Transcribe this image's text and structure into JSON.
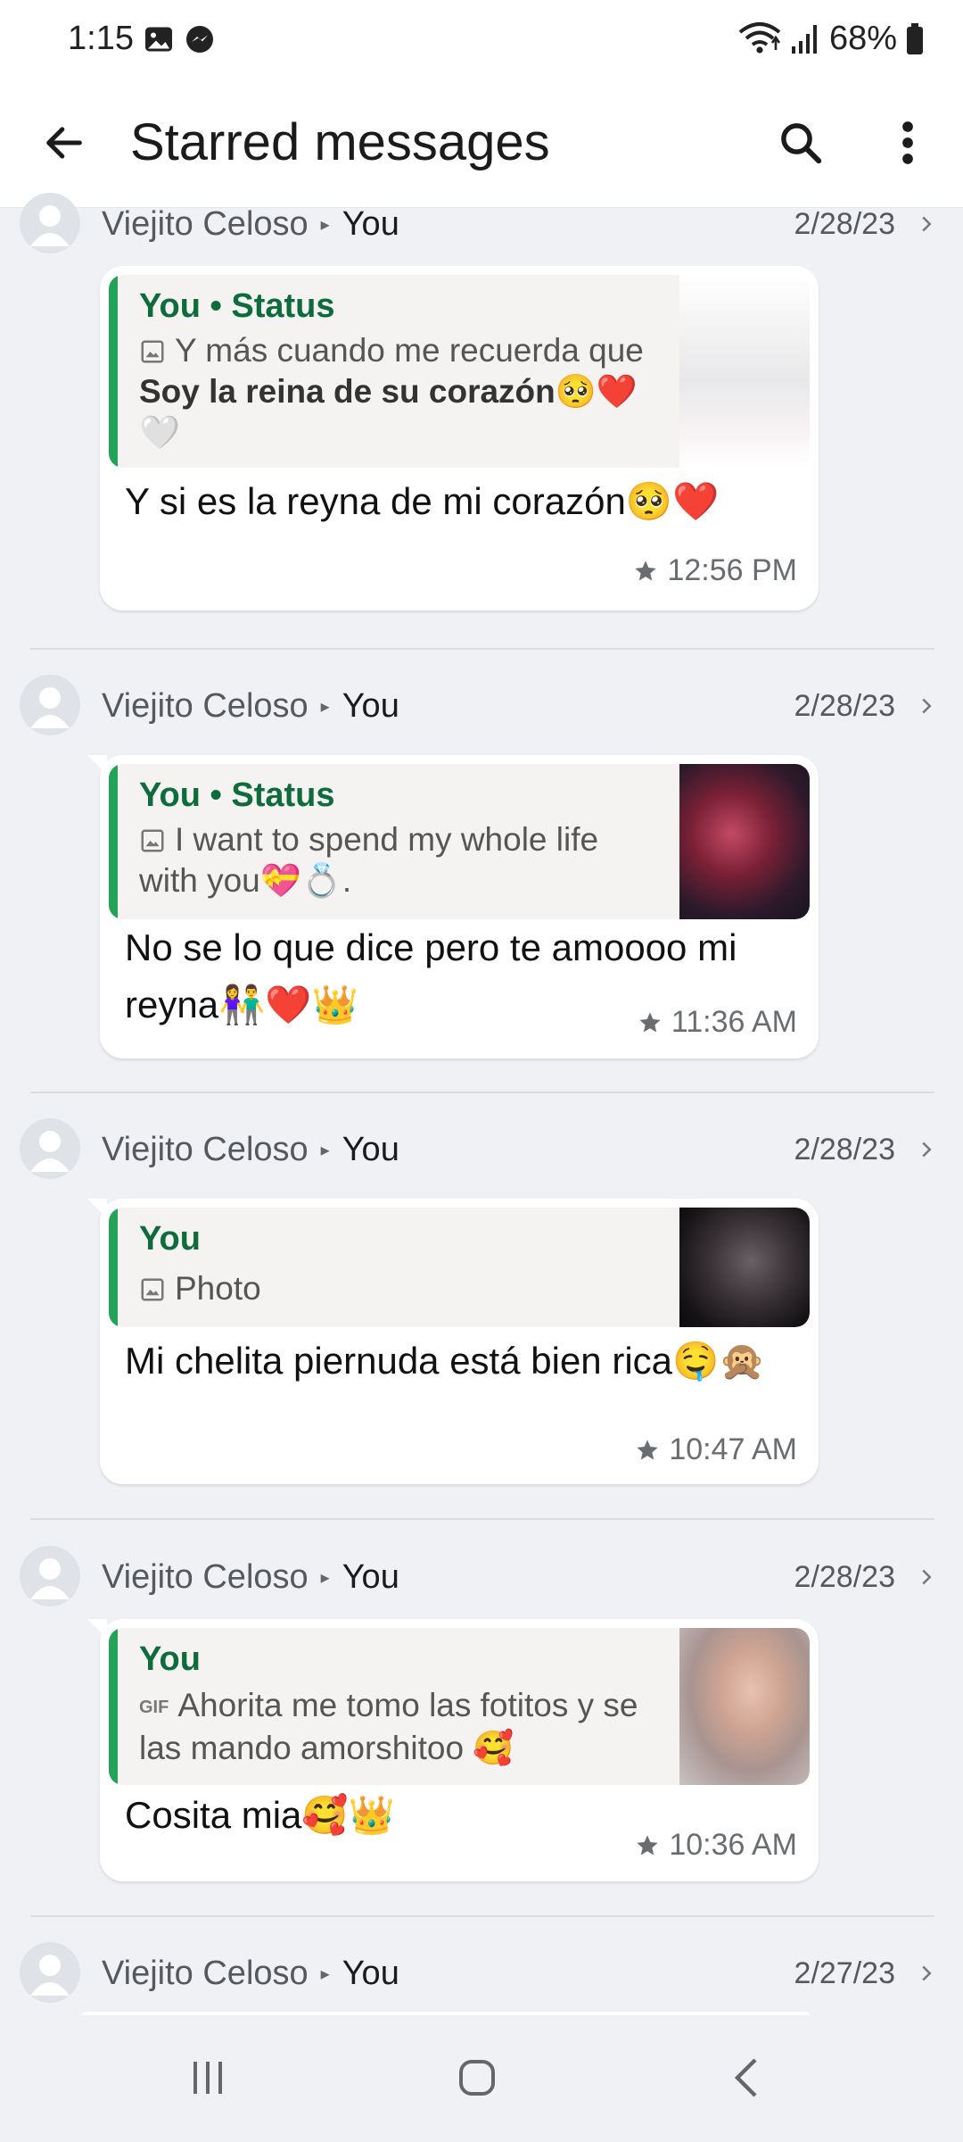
{
  "status_bar": {
    "time": "1:15",
    "battery": "68%"
  },
  "appbar": {
    "title": "Starred messages"
  },
  "messages": [
    {
      "sender": "Viejito Celoso",
      "recipient": "You",
      "date": "2/28/23",
      "quote_author": "You • Status",
      "quote_text_a": "Y más cuando me recuerda que ",
      "quote_text_b": "Soy la reina de su corazón",
      "quote_text_c": "🥺❤️🤍",
      "text": "Y si es la reyna de mi corazón🥺❤️",
      "time": "12:56 PM"
    },
    {
      "sender": "Viejito Celoso",
      "recipient": "You",
      "date": "2/28/23",
      "quote_author": "You • Status",
      "quote_text": "I want to spend my whole life with you💝💍.",
      "text": "No se lo que dice pero te amoooo mi reyna👫❤️👑",
      "time": "11:36 AM"
    },
    {
      "sender": "Viejito Celoso",
      "recipient": "You",
      "date": "2/28/23",
      "quote_author": "You",
      "quote_text": "Photo",
      "text": "Mi chelita piernuda está bien rica🤤🙊",
      "time": "10:47 AM"
    },
    {
      "sender": "Viejito Celoso",
      "recipient": "You",
      "date": "2/28/23",
      "quote_author": "You",
      "quote_text": "Ahorita me tomo las fotitos y se las mando amorshitoo 🥰",
      "quote_icon_label": "GIF",
      "text": "Cosita mia🥰👑",
      "time": "10:36 AM"
    },
    {
      "sender": "Viejito Celoso",
      "recipient": "You",
      "date": "2/27/23"
    }
  ],
  "icons": {
    "back": "arrow-left-icon",
    "search": "search-icon",
    "more": "more-vert-icon",
    "star": "star-icon"
  },
  "colors": {
    "accent_green": "#25a25a",
    "quote_author": "#0e6b3b",
    "background": "#f0f1f5"
  }
}
